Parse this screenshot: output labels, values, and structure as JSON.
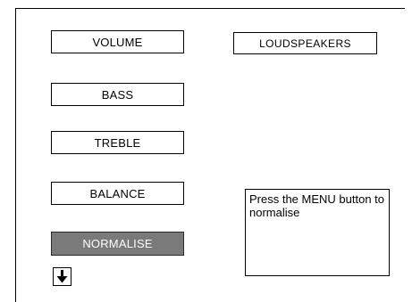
{
  "menu": {
    "volume_label": "VOLUME",
    "bass_label": "BASS",
    "treble_label": "TREBLE",
    "balance_label": "BALANCE",
    "normalise_label": "NORMALISE",
    "loudspeakers_label": "LOUDSPEAKERS"
  },
  "info": {
    "message": "Press the MENU button to normalise"
  },
  "navigation": {
    "down_icon": "arrow-down-icon"
  },
  "colors": {
    "selected_background": "#7a7a7a",
    "selected_text": "#ffffff"
  }
}
